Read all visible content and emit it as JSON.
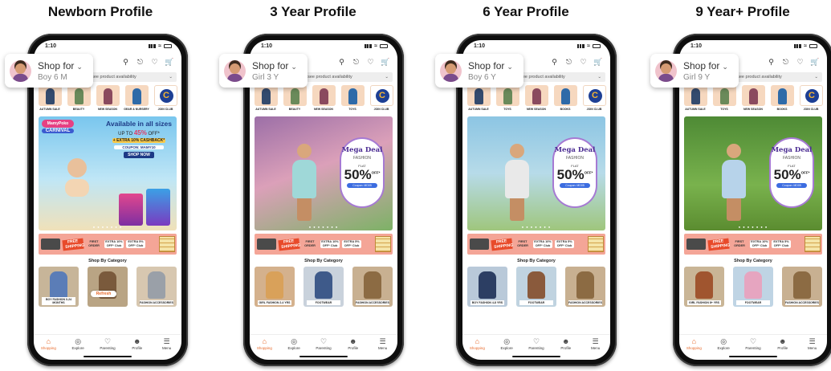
{
  "columns": [
    {
      "title": "Newborn Profile",
      "profile": {
        "label": "Shop for",
        "sub": "Boy 6 M"
      },
      "status_time": "1:10",
      "availability": "to see product availability",
      "categories": [
        "AUTUMN SALE",
        "BEAUTY",
        "NEW SEASON",
        "GEAR & NURSERY",
        "JOIN CLUB"
      ],
      "banner": {
        "type": "carnival",
        "logo_line1": "MamyPoko",
        "logo_line2": "CARNIVAL",
        "headline": "Available in all sizes",
        "line1_prefix": "UP TO",
        "line1_pct": "45%",
        "line1_suffix": "OFF*",
        "line2": "+ EXTRA 10% CASHBACK*",
        "coupon": "COUPON: MAMY10",
        "cta": "SHOP NOW"
      },
      "shipping": {
        "free": "FREE SHIPPING",
        "first_order": "FIRST ORDER",
        "offer1": "EXTRA 10% OFF* Club",
        "offer2": "EXTRA 5% OFF* Club",
        "coupon": "Coupon: NEW5"
      },
      "shop_by_category": "Shop By Category",
      "tiles": [
        {
          "label": "BOY FASHION 0-24 MONTHS",
          "color": "#c7b599",
          "fig": "#5b7db7"
        },
        {
          "label": "",
          "color": "#b9a484",
          "fig": "#7a5a3c"
        },
        {
          "label": "FASHION ACCESSORIES",
          "color": "#d7c7b0",
          "fig": "#9aa0a8"
        }
      ],
      "refresh": "Refresh",
      "tabs": [
        "Shopping",
        "Explore",
        "Parenting",
        "Profile",
        "Menu"
      ]
    },
    {
      "title": "3 Year Profile",
      "profile": {
        "label": "Shop for",
        "sub": "Girl 3 Y"
      },
      "status_time": "1:10",
      "availability": "to see product availability",
      "categories": [
        "AUTUMN SALE",
        "BEAUTY",
        "NEW SEASON",
        "TOYS",
        "JOIN CLUB"
      ],
      "banner": {
        "type": "deal",
        "deal_title": "Mega Deal",
        "deal_sub": "FASHION",
        "deal_flat": "FLAT",
        "deal_pct": "50%",
        "deal_off": "OFF*",
        "deal_code": "Coupon: MD05"
      },
      "shipping": {
        "free": "FREE SHIPPING",
        "first_order": "FIRST ORDER",
        "offer1": "EXTRA 10% OFF* Club",
        "offer2": "EXTRA 5% OFF* Club",
        "coupon": "Coupon: NEW5"
      },
      "shop_by_category": "Shop By Category",
      "tiles": [
        {
          "label": "GIRL FASHION 2-4 YRS",
          "color": "#d4b18d",
          "fig": "#d9a15a"
        },
        {
          "label": "FOOTWEAR",
          "color": "#c9d2dc",
          "fig": "#3e5a8a"
        },
        {
          "label": "FASHION ACCESSORIES",
          "color": "#c8b091",
          "fig": "#8c6b43"
        }
      ],
      "tabs": [
        "Shopping",
        "Explore",
        "Parenting",
        "Profile",
        "Menu"
      ]
    },
    {
      "title": "6 Year Profile",
      "profile": {
        "label": "Shop for",
        "sub": "Boy 6 Y"
      },
      "status_time": "1:10",
      "availability": "to see product availability",
      "categories": [
        "AUTUMN SALE",
        "TOYS",
        "NEW SEASON",
        "BOOKS",
        "JOIN CLUB"
      ],
      "banner": {
        "type": "deal",
        "deal_title": "Mega Deal",
        "deal_sub": "FASHION",
        "deal_flat": "FLAT",
        "deal_pct": "50%",
        "deal_off": "OFF*",
        "deal_code": "Coupon: MD05"
      },
      "shipping": {
        "free": "FREE SHIPPING",
        "first_order": "FIRST ORDER",
        "offer1": "EXTRA 10% OFF* Club",
        "offer2": "EXTRA 5% OFF* Club",
        "coupon": "Coupon: NEW5"
      },
      "shop_by_category": "Shop By Category",
      "tiles": [
        {
          "label": "BOY FASHION 4-8 YRS",
          "color": "#b9c9d9",
          "fig": "#2c3e63"
        },
        {
          "label": "FOOTWEAR",
          "color": "#c0d3e0",
          "fig": "#8a5a3c"
        },
        {
          "label": "FASHION ACCESSORIES",
          "color": "#c8b091",
          "fig": "#8c6b43"
        }
      ],
      "tabs": [
        "Shopping",
        "Explore",
        "Parenting",
        "Profile",
        "Menu"
      ]
    },
    {
      "title": "9 Year+ Profile",
      "profile": {
        "label": "Shop for",
        "sub": "Girl 9 Y"
      },
      "status_time": "1:10",
      "availability": "to see product availability",
      "categories": [
        "AUTUMN SALE",
        "TOYS",
        "NEW SEASON",
        "BOOKS",
        "JOIN CLUB"
      ],
      "banner": {
        "type": "deal",
        "deal_title": "Mega Deal",
        "deal_sub": "FASHION",
        "deal_flat": "FLAT",
        "deal_pct": "50%",
        "deal_off": "OFF*",
        "deal_code": "Coupon: MD05"
      },
      "shipping": {
        "free": "FREE SHIPPING",
        "first_order": "FIRST ORDER",
        "offer1": "EXTRA 10% OFF* Club",
        "offer2": "EXTRA 5% OFF* Club",
        "coupon": "Coupon: NEW5"
      },
      "shop_by_category": "Shop By Category",
      "tiles": [
        {
          "label": "GIRL FASHION 8+ YRS",
          "color": "#c9b596",
          "fig": "#a0552f"
        },
        {
          "label": "FOOTWEAR",
          "color": "#bfd4e4",
          "fig": "#e6a5c0"
        },
        {
          "label": "FASHION ACCESSORIES",
          "color": "#c8b091",
          "fig": "#8c6b43"
        }
      ],
      "tabs": [
        "Shopping",
        "Explore",
        "Parenting",
        "Profile",
        "Menu"
      ]
    }
  ]
}
